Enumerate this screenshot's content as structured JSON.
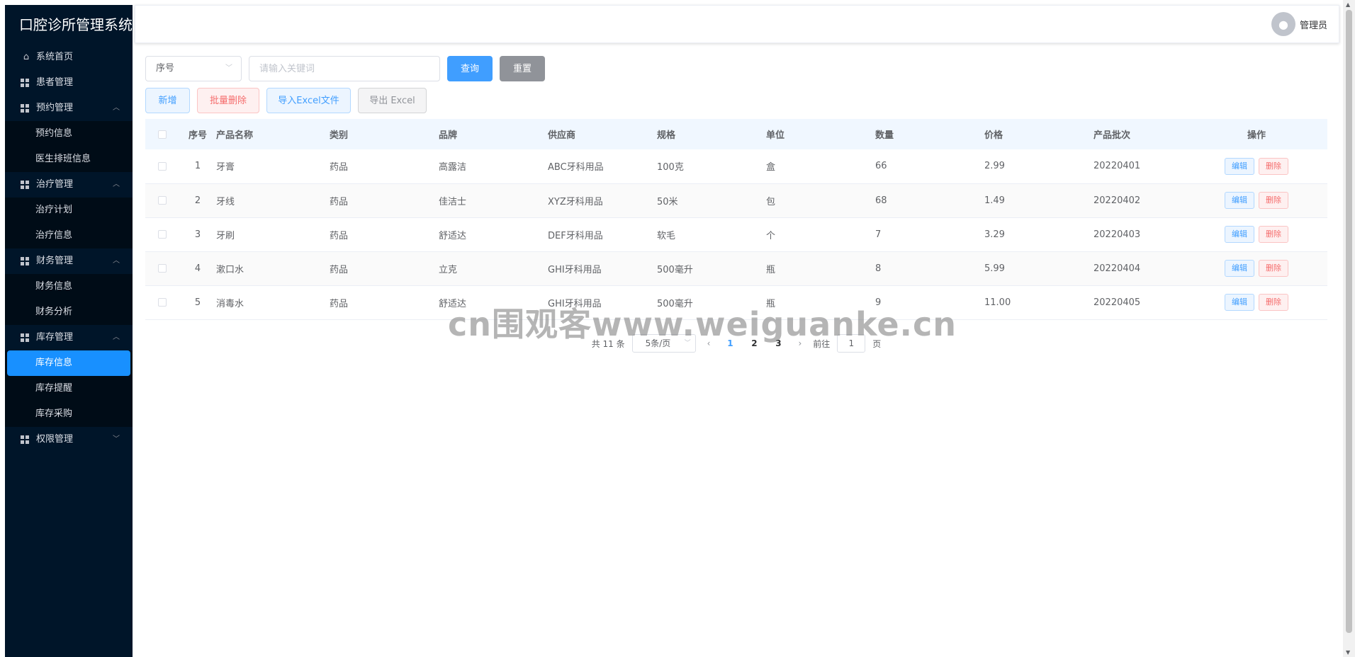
{
  "app": {
    "title": "口腔诊所管理系统"
  },
  "user": {
    "name": "管理员",
    "icon": "user-icon"
  },
  "sidebar": {
    "items": [
      {
        "label": "系统首页",
        "icon": "home-icon"
      },
      {
        "label": "患者管理",
        "icon": "grid-icon"
      },
      {
        "label": "预约管理",
        "icon": "grid-icon",
        "children": [
          "预约信息",
          "医生排班信息"
        ]
      },
      {
        "label": "治疗管理",
        "icon": "grid-icon",
        "children": [
          "治疗计划",
          "治疗信息"
        ]
      },
      {
        "label": "财务管理",
        "icon": "grid-icon",
        "children": [
          "财务信息",
          "财务分析"
        ]
      },
      {
        "label": "库存管理",
        "icon": "grid-icon",
        "children": [
          "库存信息",
          "库存提醒",
          "库存采购"
        ]
      },
      {
        "label": "权限管理",
        "icon": "grid-icon"
      }
    ],
    "active": "库存信息"
  },
  "search": {
    "field_select": "序号",
    "placeholder": "请输入关键词",
    "query_label": "查询",
    "reset_label": "重置"
  },
  "actions": {
    "add": "新增",
    "batch_delete": "批量删除",
    "import": "导入Excel文件",
    "export": "导出 Excel"
  },
  "table": {
    "columns": [
      "序号",
      "产品名称",
      "类别",
      "品牌",
      "供应商",
      "规格",
      "单位",
      "数量",
      "价格",
      "产品批次",
      "操作"
    ],
    "rows": [
      [
        "1",
        "牙膏",
        "药品",
        "高露洁",
        "ABC牙科用品",
        "100克",
        "盒",
        "66",
        "2.99",
        "20220401"
      ],
      [
        "2",
        "牙线",
        "药品",
        "佳洁士",
        "XYZ牙科用品",
        "50米",
        "包",
        "68",
        "1.49",
        "20220402"
      ],
      [
        "3",
        "牙刷",
        "药品",
        "舒适达",
        "DEF牙科用品",
        "软毛",
        "个",
        "7",
        "3.29",
        "20220403"
      ],
      [
        "4",
        "漱口水",
        "药品",
        "立克",
        "GHI牙科用品",
        "500毫升",
        "瓶",
        "8",
        "5.99",
        "20220404"
      ],
      [
        "5",
        "消毒水",
        "药品",
        "舒适达",
        "GHI牙科用品",
        "500毫升",
        "瓶",
        "9",
        "11.00",
        "20220405"
      ]
    ],
    "edit_label": "编辑",
    "delete_label": "删除"
  },
  "pagination": {
    "total": "共 11 条",
    "page_size": "5条/页",
    "pages": [
      "1",
      "2",
      "3"
    ],
    "current": "1",
    "goto_prefix": "前往",
    "goto_value": "1",
    "goto_suffix": "页"
  },
  "watermark": "cn围观客www.weiguanke.cn"
}
